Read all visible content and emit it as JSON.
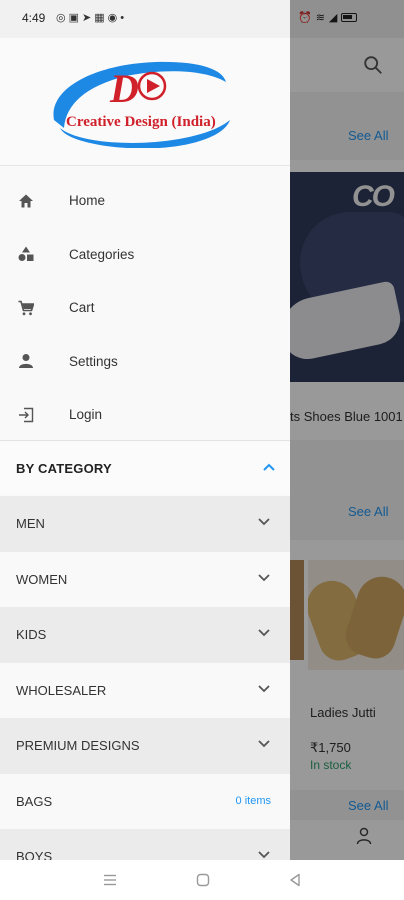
{
  "status_bar": {
    "time": "4:49",
    "left_icons": [
      "whatsapp-icon",
      "image-icon",
      "telegram-icon",
      "facebook-icon",
      "messenger-icon",
      "dot-icon"
    ],
    "right_icons": [
      "alarm-icon",
      "wifi-icon",
      "signal-icon",
      "battery-icon"
    ]
  },
  "drawer": {
    "logo": {
      "text": "Creative Design (India)",
      "colors": {
        "red": "#d0202a",
        "blue": "#1e88e5"
      }
    },
    "menu": [
      {
        "label": "Home",
        "icon": "home-icon"
      },
      {
        "label": "Categories",
        "icon": "categories-icon"
      },
      {
        "label": "Cart",
        "icon": "cart-icon"
      },
      {
        "label": "Settings",
        "icon": "person-icon"
      },
      {
        "label": "Login",
        "icon": "login-icon"
      }
    ],
    "category_header": {
      "label": "BY CATEGORY",
      "expanded": true
    },
    "categories": [
      {
        "name": "MEN"
      },
      {
        "name": "WOMEN"
      },
      {
        "name": "KIDS"
      },
      {
        "name": "WHOLESALER"
      },
      {
        "name": "PREMIUM DESIGNS"
      },
      {
        "name": "BAGS",
        "count": "0 items"
      },
      {
        "name": "BOYS"
      }
    ]
  },
  "background": {
    "see_all_1": "See All",
    "see_all_2": "See All",
    "see_all_3": "See All",
    "product_1_name": "ts Shoes Blue 1001",
    "product_1_logo": "CO",
    "product_2_name": "Ladies Jutti",
    "product_2_price": "₹1,750",
    "product_2_stock": "In stock"
  },
  "colors": {
    "accent": "#2196f3",
    "instock": "#2e9d6b"
  }
}
